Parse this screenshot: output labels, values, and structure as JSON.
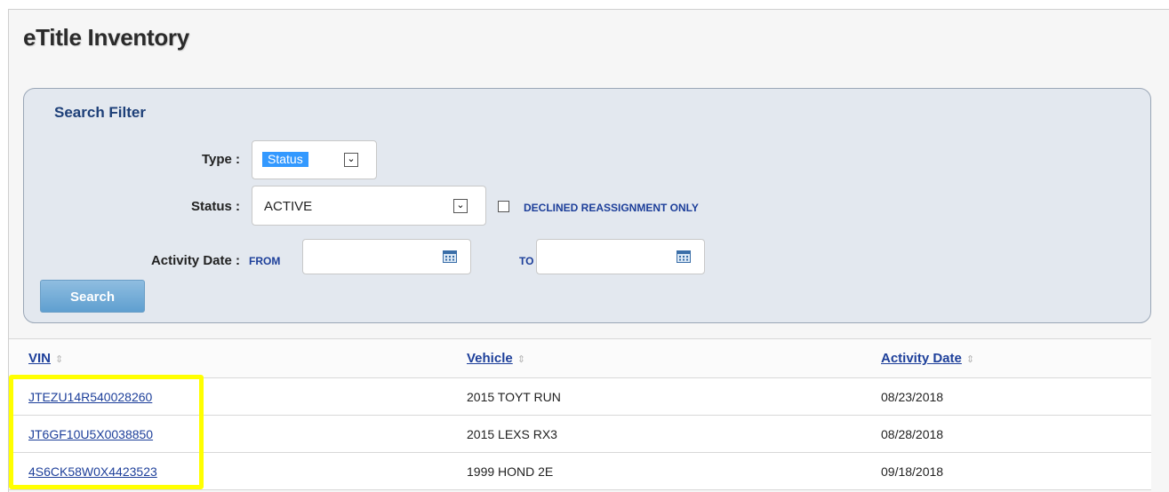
{
  "page": {
    "title": "eTitle Inventory"
  },
  "filter": {
    "title": "Search Filter",
    "type_label": "Type :",
    "type_value": "Status",
    "status_label": "Status :",
    "status_value": "ACTIVE",
    "declined_label": "DECLINED REASSIGNMENT ONLY",
    "declined_checked": false,
    "activity_label": "Activity Date :",
    "from_label": "FROM",
    "to_label": "TO",
    "from_value": "",
    "to_value": "",
    "search_label": "Search"
  },
  "table": {
    "columns": [
      "VIN",
      "Vehicle",
      "Activity Date"
    ],
    "rows": [
      {
        "vin": "JTEZU14R540028260",
        "vehicle": "2015 TOYT RUN",
        "date": "08/23/2018"
      },
      {
        "vin": "JT6GF10U5X0038850",
        "vehicle": "2015 LEXS RX3",
        "date": "08/28/2018"
      },
      {
        "vin": "4S6CK58W0X4423523",
        "vehicle": "1999 HOND 2E",
        "date": "09/18/2018"
      }
    ]
  },
  "colors": {
    "accent_blue": "#1d3f9a",
    "highlight": "#ffff00",
    "button": "#5f9fd0"
  }
}
